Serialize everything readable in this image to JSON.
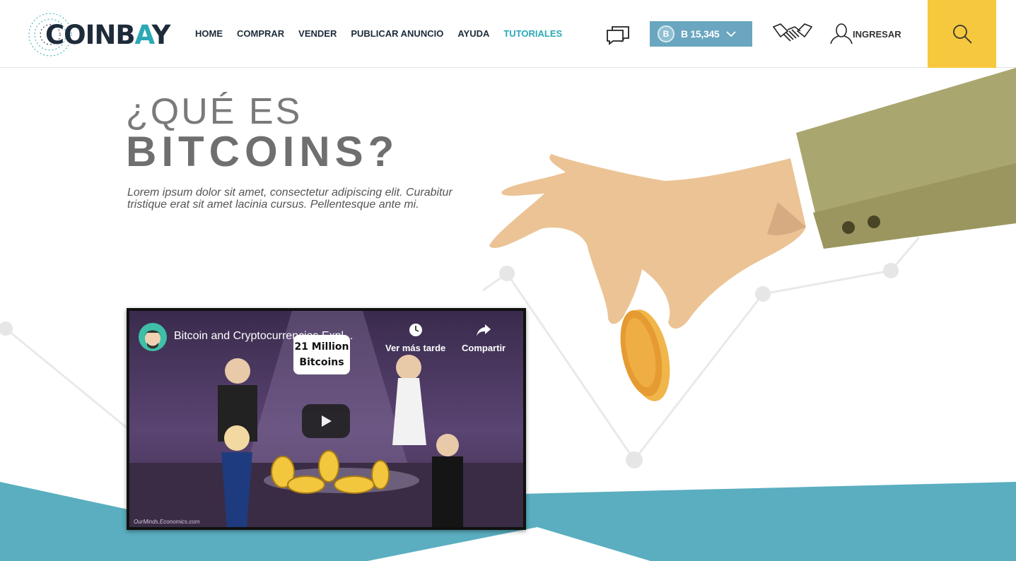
{
  "brand": {
    "logo_prefix": "COINB",
    "logo_accent": "A",
    "logo_suffix": "Y"
  },
  "nav": {
    "items": [
      {
        "label": "HOME",
        "active": false
      },
      {
        "label": "COMPRAR",
        "active": false
      },
      {
        "label": "VENDER",
        "active": false
      },
      {
        "label": "PUBLICAR ANUNCIO",
        "active": false
      },
      {
        "label": "AYUDA",
        "active": false
      },
      {
        "label": "TUTORIALES",
        "active": true
      }
    ]
  },
  "header": {
    "balance_symbol": "B",
    "balance_amount": "B 15,345",
    "login_label": "INGRESAR"
  },
  "hero": {
    "title_line1": "¿QUÉ ES",
    "title_line2": "BITCOINS?",
    "description": "Lorem ipsum dolor sit amet, consectetur adipiscing elit. Curabitur tristique erat sit amet lacinia cursus. Pellentesque ante mi."
  },
  "video": {
    "title": "Bitcoin and Cryptocurrencies Expl...",
    "watch_later_label": "Ver más tarde",
    "share_label": "Compartir",
    "speech_line1": "21 Million",
    "speech_line2": "Bitcoins",
    "watermark": "OurMinds.Economics.com"
  },
  "colors": {
    "accent_teal": "#2ba9b6",
    "balance_bg": "#6aa6bf",
    "search_yellow": "#f6c83e",
    "wave_blue": "#5aaec0",
    "sleeve_olive": "#a9a570",
    "coin_gold": "#e8a43a"
  },
  "icons": {
    "chat": "chat-bubbles-icon",
    "handshake": "handshake-icon",
    "user": "user-icon",
    "search": "search-icon",
    "chevron": "chevron-down-icon",
    "play": "play-icon",
    "clock": "clock-icon",
    "share": "share-icon"
  }
}
